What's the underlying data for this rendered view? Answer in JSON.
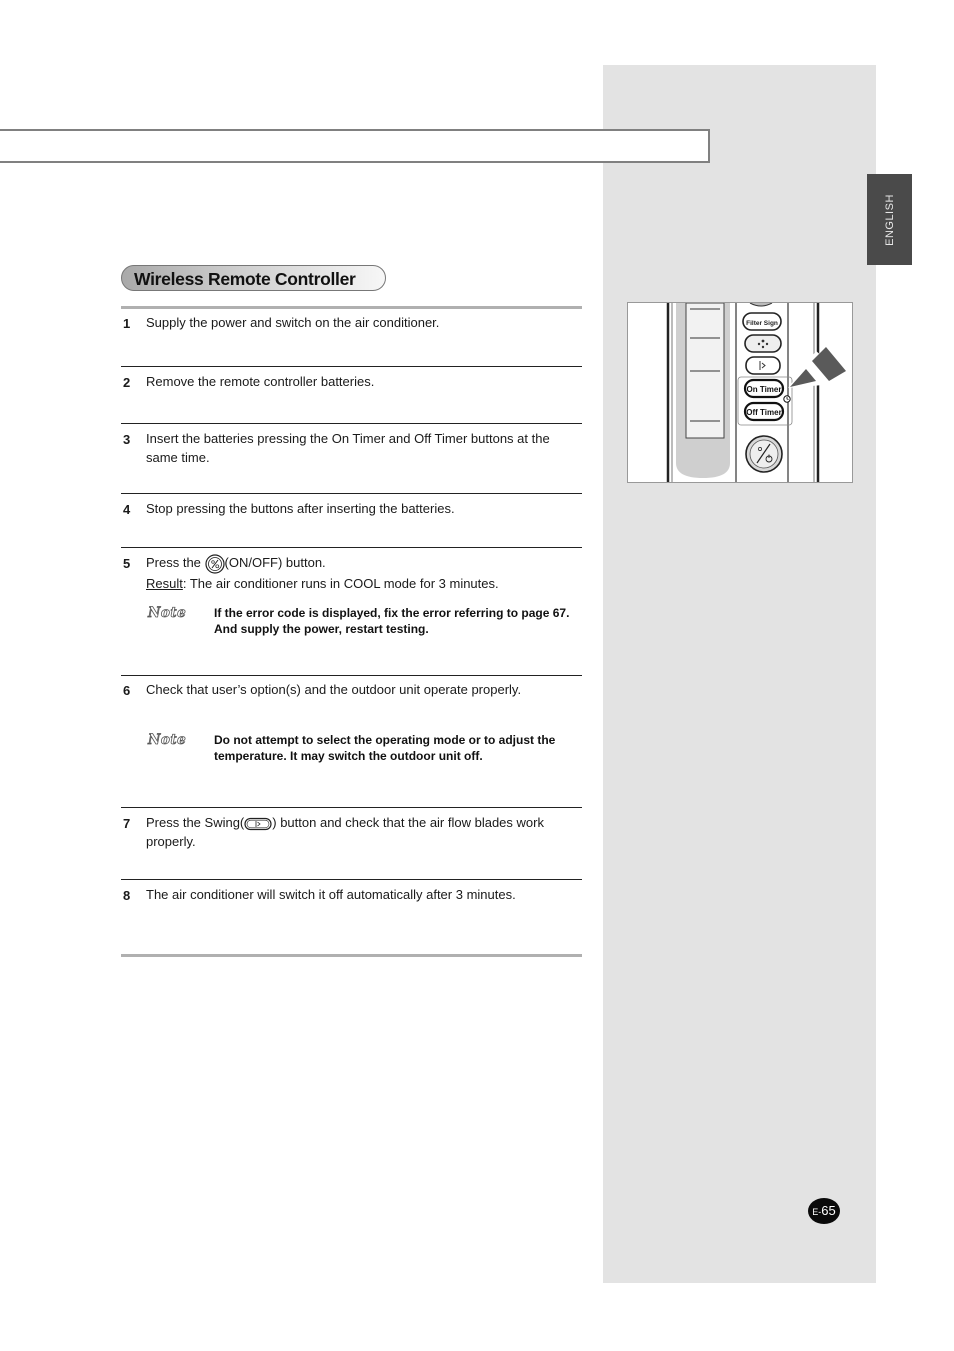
{
  "page": {
    "language_tab": "ENGLISH",
    "section_title": "Wireless Remote Controller",
    "page_number_prefix": "E-",
    "page_number": "65"
  },
  "steps": [
    {
      "num": "1",
      "text": "Supply the power and switch on the air conditioner."
    },
    {
      "num": "2",
      "text": "Remove the remote controller batteries."
    },
    {
      "num": "3",
      "text": "Insert the batteries pressing the On Timer and Off Timer buttons at the same time."
    },
    {
      "num": "4",
      "text": "Stop pressing the buttons after inserting the batteries."
    },
    {
      "num": "5",
      "text_before": "Press the ",
      "text_after": "(ON/OFF) button.",
      "result_label": "Result",
      "result_text": ": The air conditioner runs in COOL mode for 3 minutes."
    },
    {
      "num": "6",
      "text": "Check that user’s option(s) and the outdoor unit operate properly."
    },
    {
      "num": "7",
      "text_before": "Press the Swing(",
      "text_after": ") button and check that the air flow blades work properly."
    },
    {
      "num": "8",
      "text": "The air conditioner will switch it off automatically after 3 minutes."
    }
  ],
  "notes": [
    {
      "label": "Note",
      "text": "If the error code is displayed, fix the error referring to page 67. And supply the power, restart testing."
    },
    {
      "label": "Note",
      "text": "Do not attempt to select the operating mode or to adjust the temperature. It may switch the outdoor unit off."
    }
  ],
  "figure": {
    "buttons": [
      "Filter Sign",
      "On Timer",
      "Off Timer"
    ],
    "icons": [
      "fan-speed-icon",
      "swing-icon",
      "clock-icon",
      "on-off-button"
    ]
  }
}
